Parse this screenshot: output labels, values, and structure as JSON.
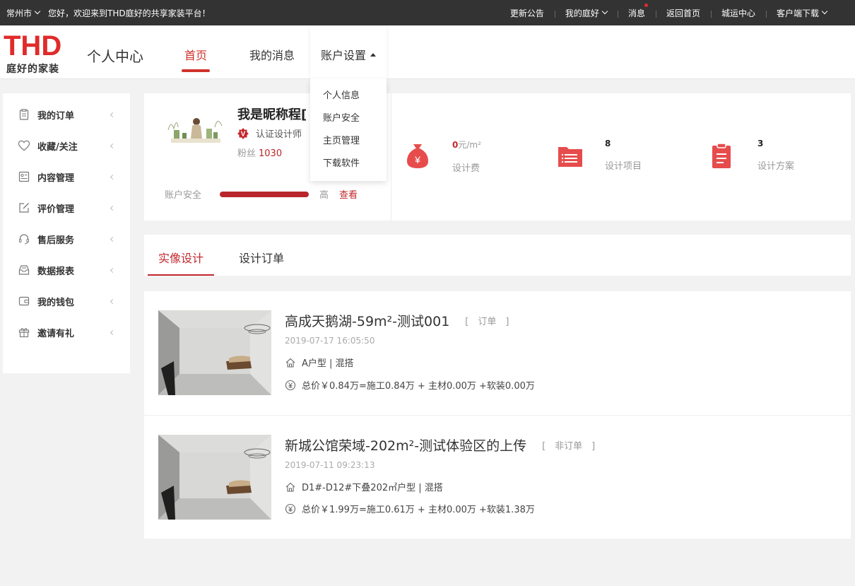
{
  "topbar": {
    "city": "常州市",
    "welcome": "您好，欢迎来到THD庭好的共享家装平台！",
    "links": {
      "notice": "更新公告",
      "my_tinghao": "我的庭好",
      "message": "消息",
      "back_home": "返回首页",
      "city_center": "城运中心",
      "client_download": "客户端下载"
    }
  },
  "header": {
    "logo_text": "THD",
    "logo_sub": "庭好的家装",
    "page_title": "个人中心",
    "nav": {
      "home": "首页",
      "messages": "我的消息",
      "account": "账户设置"
    }
  },
  "dropdown": {
    "items": [
      "个人信息",
      "账户安全",
      "主页管理",
      "下载软件"
    ]
  },
  "sidebar": {
    "items": [
      {
        "label": "我的订单",
        "icon": "clipboard-icon"
      },
      {
        "label": "收藏/关注",
        "icon": "heart-icon"
      },
      {
        "label": "内容管理",
        "icon": "id-card-icon"
      },
      {
        "label": "评价管理",
        "icon": "edit-icon"
      },
      {
        "label": "售后服务",
        "icon": "headset-icon"
      },
      {
        "label": "数据报表",
        "icon": "inbox-icon"
      },
      {
        "label": "我的钱包",
        "icon": "wallet-icon"
      },
      {
        "label": "邀请有礼",
        "icon": "gift-icon"
      }
    ]
  },
  "profile": {
    "nickname": "我是昵称程[",
    "cert_label": "认证设计师",
    "fans_label": "粉丝",
    "fans_count": "1030",
    "security_label": "账户安全",
    "security_level": "高",
    "security_link": "查看",
    "security_progress": 1.0,
    "stats": [
      {
        "value": "0",
        "unit": "元/m²",
        "label": "设计费",
        "icon": "money-bag-icon"
      },
      {
        "value": "8",
        "unit": "",
        "label": "设计项目",
        "icon": "folder-list-icon"
      },
      {
        "value": "3",
        "unit": "",
        "label": "设计方案",
        "icon": "clipboard-list-icon"
      }
    ]
  },
  "tabs": {
    "active": "实像设计",
    "second": "设计订单"
  },
  "designs": [
    {
      "title": "高成天鹅湖-59m²-测试001",
      "tag": "[　订单　]",
      "date": "2019-07-17 16:05:50",
      "layout": "A户型 | 混搭",
      "price": "总价￥0.84万=施工0.84万 + 主材0.00万 +软装0.00万"
    },
    {
      "title": "新城公馆荣域-202m²-测试体验区的上传",
      "tag": "[　非订单　]",
      "date": "2019-07-11 09:23:13",
      "layout": "D1#-D12#下叠202㎡户型 | 混搭",
      "price": "总价￥1.99万=施工0.61万 + 主材0.00万 +软装1.38万"
    }
  ],
  "colors": {
    "accent": "#c2282d",
    "topbar": "#333333",
    "brand_red": "#e02b2b"
  }
}
